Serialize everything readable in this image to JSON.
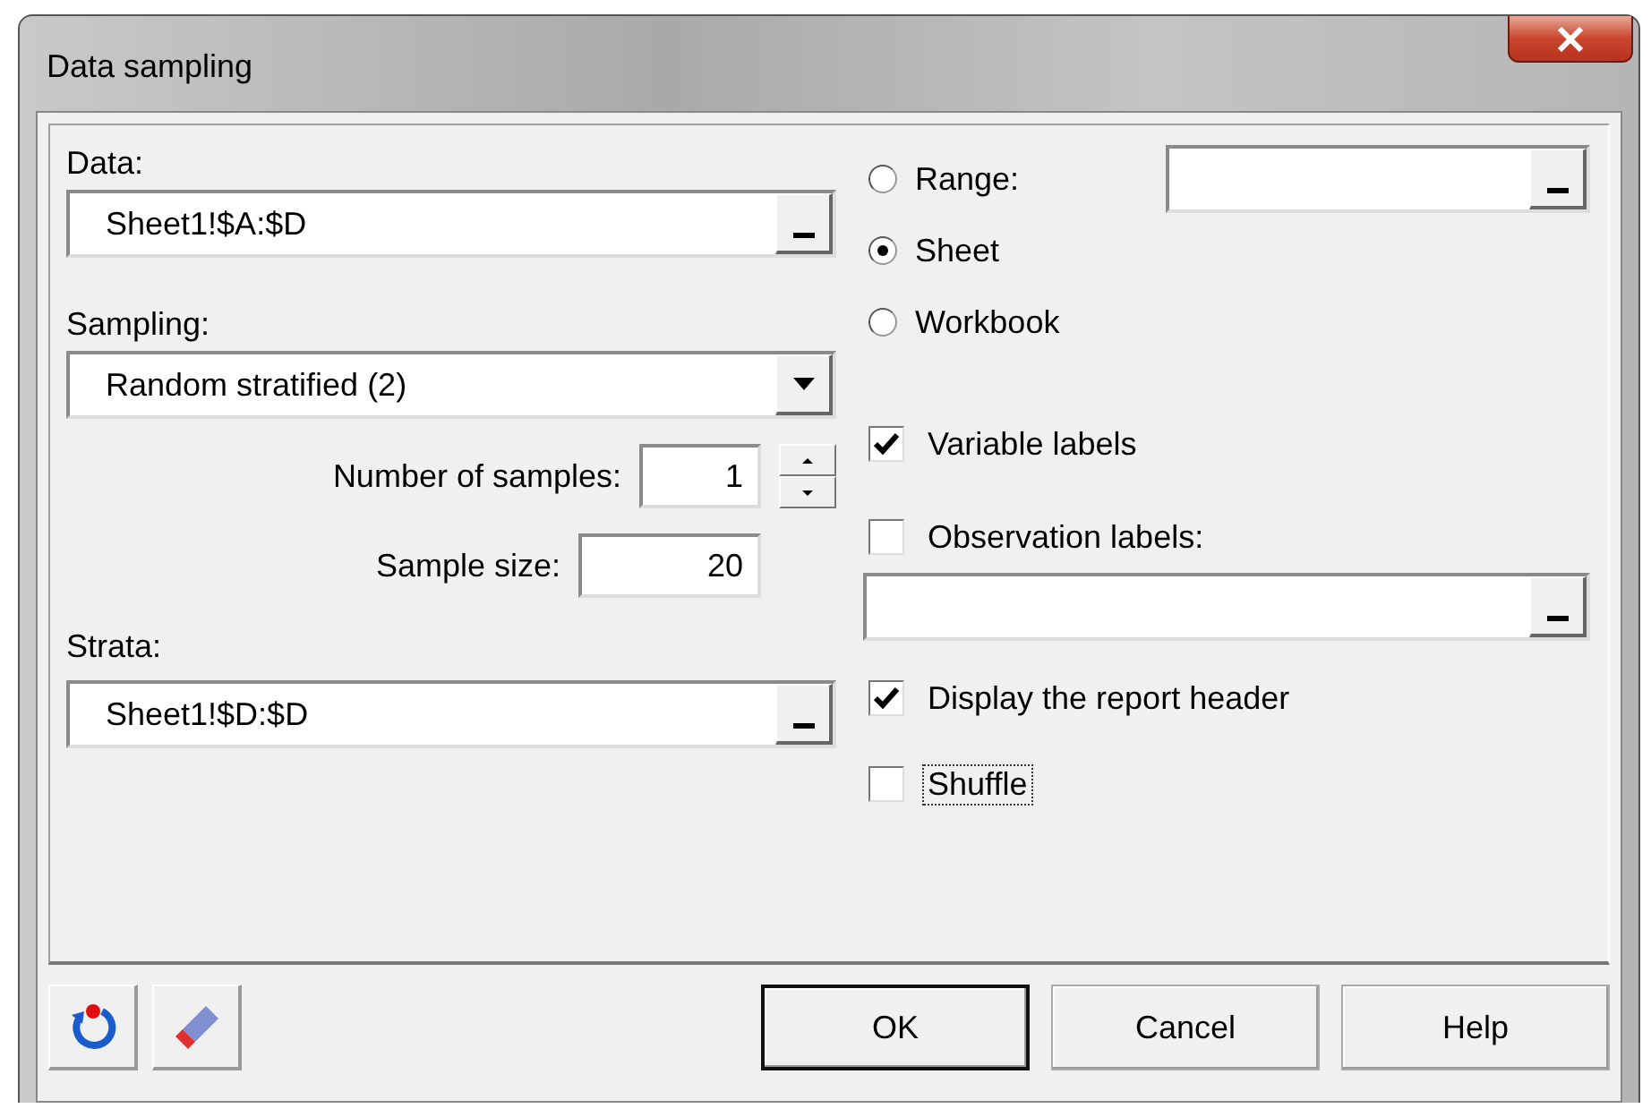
{
  "window": {
    "title": "Data sampling"
  },
  "data": {
    "label": "Data:",
    "value": "Sheet1!$A:$D"
  },
  "sampling": {
    "label": "Sampling:",
    "value": "Random stratified (2)"
  },
  "number_of_samples": {
    "label": "Number of samples:",
    "value": "1"
  },
  "sample_size": {
    "label": "Sample size:",
    "value": "20"
  },
  "strata": {
    "label": "Strata:",
    "value": "Sheet1!$D:$D"
  },
  "scope": [
    {
      "label": "Range:",
      "selected": false
    },
    {
      "label": "Sheet",
      "selected": true
    },
    {
      "label": "Workbook",
      "selected": false
    }
  ],
  "options": [
    {
      "label": "Variable labels",
      "checked": true,
      "focused": false,
      "has_field": false
    },
    {
      "label": "Observation labels:",
      "checked": false,
      "focused": false,
      "has_field": true
    },
    {
      "label": "Display the report header",
      "checked": true,
      "focused": false,
      "has_field": false
    },
    {
      "label": "Shuffle",
      "checked": false,
      "focused": true,
      "has_field": false
    }
  ],
  "buttons": [
    {
      "label": "OK",
      "default": true
    },
    {
      "label": "Cancel",
      "default": false
    },
    {
      "label": "Help",
      "default": false
    }
  ]
}
